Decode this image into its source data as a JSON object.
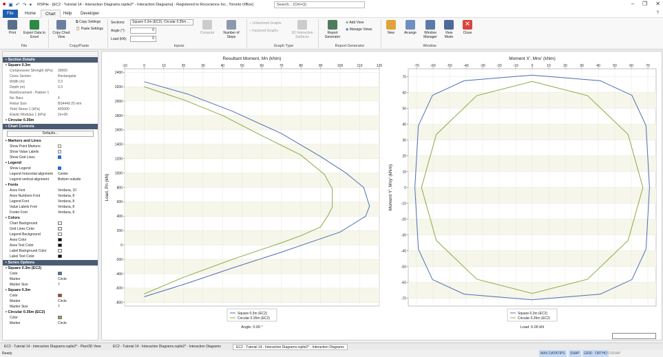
{
  "window": {
    "title": "RSPile - [EC2 - Tutorial 14 - Interaction Diagrams.rspile2* - Interaction Diagrams] - Registered to Rocscience Inc., Toronto Office]",
    "search_placeholder": "Search... (Ctrl+Q)"
  },
  "menu": {
    "file": "File",
    "home": "Home",
    "chart": "Chart",
    "help": "Help",
    "developer": "Developer"
  },
  "ribbon": {
    "print": "Print",
    "export": "Export Data to Excel",
    "copy_chart": "Copy Chart View",
    "copy_settings": "Copy Settings",
    "paste_settings": "Paste Settings",
    "sections_label": "Sections:",
    "sections_value": "Square 0.3m (EC2), Circular 0.35m ...",
    "angle_label": "Angle (°):",
    "angle_value": "0",
    "load_label": "Load (kN):",
    "load_value": "0",
    "compute": "Compute",
    "steps": "Number of Steps",
    "unfactored": "Unfactored Graphs",
    "factored": "Factored Graphs",
    "surfaces": "3D Interaction Surfaces",
    "report_gen": "Report Generator",
    "add_view": "Add View",
    "manage_views": "Manage Views",
    "new": "New",
    "arrange": "Arrange",
    "window_manager": "Window Manager",
    "view_mode": "View Mode",
    "close": "Close",
    "groups": {
      "file": "File",
      "copy_paste": "Copy/Paste",
      "inputs": "Inputs",
      "graph_type": "Graph Type",
      "report": "Report Generator",
      "window": "Window"
    }
  },
  "panel": {
    "section_details": "Section Details",
    "square": "Square 0.3m",
    "props": [
      {
        "k": "Compressive Strength (kPa)",
        "v": "30000"
      },
      {
        "k": "Cross Section",
        "v": "Rectangular"
      },
      {
        "k": "Width (m)",
        "v": "0.3"
      },
      {
        "k": "Depth (m)",
        "v": "0.3"
      },
      {
        "k": "Reinforcement - Pattern 1",
        "v": ""
      },
      {
        "k": "No. Bars",
        "v": "4"
      },
      {
        "k": "Rebar Size",
        "v": "BS4449 25 mm"
      },
      {
        "k": "Yield Stress 1 (kPa)",
        "v": "420000"
      },
      {
        "k": "Elastic Modulus 1 (kPa)",
        "v": "2e+08"
      }
    ],
    "circular": "Circular 0.35m",
    "chart_controls": "Chart Controls",
    "defaults": "Defaults...",
    "markers_lines": "Markers and Lines",
    "show_point_markers": "Show Point Markers",
    "show_value_labels": "Show Value Labels",
    "show_grid_lines": "Show Grid Lines",
    "legend": "Legend",
    "show_legend": "Show Legend",
    "legend_h": "Legend horizontal alignment",
    "legend_h_val": "Center",
    "legend_v": "Legend vertical alignment",
    "legend_v_val": "Bottom outside",
    "fonts": "Fonts",
    "font_rows": [
      {
        "k": "Axes Font",
        "v": "Verdana, 10"
      },
      {
        "k": "Axes Numbers Font",
        "v": "Verdana, 8"
      },
      {
        "k": "Legend Font",
        "v": "Verdana, 8"
      },
      {
        "k": "Value Labels Font",
        "v": "Verdana, 8"
      },
      {
        "k": "Footer Font",
        "v": "Verdana, 8"
      }
    ],
    "colors": "Colors",
    "color_rows": [
      {
        "k": "Chart Background",
        "c": "#ffffff"
      },
      {
        "k": "Grid Lines Color",
        "c": "#eeeedd"
      },
      {
        "k": "Legend Background",
        "c": "#ffffff"
      },
      {
        "k": "Axes Color",
        "c": "#000000"
      },
      {
        "k": "Axes Text Color",
        "c": "#000000"
      },
      {
        "k": "Label Background Color",
        "c": "#ffffff"
      },
      {
        "k": "Label Text Color",
        "c": "#000000"
      }
    ],
    "series_options": "Series Options",
    "sq_series": "Square 0.3m (EC2)",
    "sq_color": "Color",
    "sq_color_val": "#4a6fb5",
    "sq_marker": "Marker",
    "sq_marker_val": "Circle",
    "sq_msize": "Marker Size",
    "sq_msize_val": "7",
    "sq2": "Square 0.3m",
    "sq2_color": "Color",
    "sq2_color_val": "#c0392b",
    "sq2_marker": "Marker",
    "sq2_marker_val": "Circle",
    "sq2_msize": "Marker Size",
    "sq2_msize_val": "7",
    "circ_series": "Circular 0.35m (EC2)",
    "circ_color": "Color",
    "circ_color_val": "#8aaa44",
    "circ_marker": "Marker",
    "circ_marker_val": "Circle"
  },
  "bottom_tabs": [
    "EC2 - Tutorial 14 - Interaction Diagrams.rspile2* - Plan/3D View",
    "EC2 - Tutorial 14 - Interaction Diagrams.rspile2* - Interaction Diagrams",
    "EC2 - Tutorial 14 - Interaction Diagrams.rspile2* - Interaction Diagrams"
  ],
  "status": {
    "ready": "Ready",
    "maxdatatips": "MAX DATATIPS",
    "snap": "SNAP",
    "grid": "GRID",
    "ortho": "ORTHO",
    "osnap": "OSNAP"
  },
  "chart_data": [
    {
      "type": "line",
      "title": "Resultant Moment, Mn (kNm)",
      "xlabel": "",
      "ylabel": "Load, Pn (kN)",
      "xlim": [
        -10,
        120
      ],
      "ylim": [
        -850,
        2450
      ],
      "xticks": [
        -10,
        0,
        10,
        20,
        30,
        40,
        50,
        60,
        70,
        80,
        90,
        100,
        110,
        120
      ],
      "yticks": [
        -800,
        -600,
        -400,
        -200,
        0,
        200,
        400,
        600,
        800,
        1000,
        1200,
        1400,
        1600,
        1800,
        2000,
        2200,
        2400
      ],
      "series": [
        {
          "name": "Square 0.3m (EC2)",
          "color": "#4a6fb5",
          "x": [
            0,
            22,
            45,
            70,
            90,
            103,
            112,
            115,
            113,
            100,
            85,
            70,
            45,
            20,
            0
          ],
          "y": [
            2270,
            2100,
            1860,
            1550,
            1230,
            1000,
            800,
            540,
            400,
            180,
            40,
            -100,
            -320,
            -550,
            -720
          ]
        },
        {
          "name": "Circular 0.35m (EC2)",
          "color": "#8aaa44",
          "x": [
            0,
            20,
            40,
            60,
            80,
            92,
            96,
            96,
            94,
            90,
            80,
            70,
            45,
            20,
            0
          ],
          "y": [
            2200,
            2020,
            1800,
            1520,
            1250,
            980,
            780,
            530,
            420,
            250,
            130,
            30,
            -200,
            -450,
            -680
          ]
        }
      ],
      "legend": "bottom-center",
      "footer": "Angle: 0.00 °"
    },
    {
      "type": "line",
      "title": "Moment X', Mnx' (kNm)",
      "xlabel": "",
      "ylabel": "Moment Y', Mny' (kNm)",
      "xlim": [
        -75,
        75
      ],
      "ylim": [
        -75,
        75
      ],
      "xticks": [
        -70,
        -60,
        -50,
        -40,
        -30,
        -20,
        -10,
        0,
        10,
        20,
        30,
        40,
        50,
        60,
        70
      ],
      "yticks": [
        70,
        60,
        50,
        40,
        30,
        20,
        10,
        0,
        -10,
        -20,
        -30,
        -40,
        -50,
        -60,
        -70
      ],
      "series": [
        {
          "name": "Square 0.3m (EC2)",
          "color": "#4a6fb5",
          "shape": "square-ish",
          "extent": 71
        },
        {
          "name": "Circular 0.35m (EC2)",
          "color": "#8aaa44",
          "shape": "circle",
          "extent": 67
        }
      ],
      "legend": "bottom-center",
      "footer": "Load: 0.00 kN"
    }
  ]
}
